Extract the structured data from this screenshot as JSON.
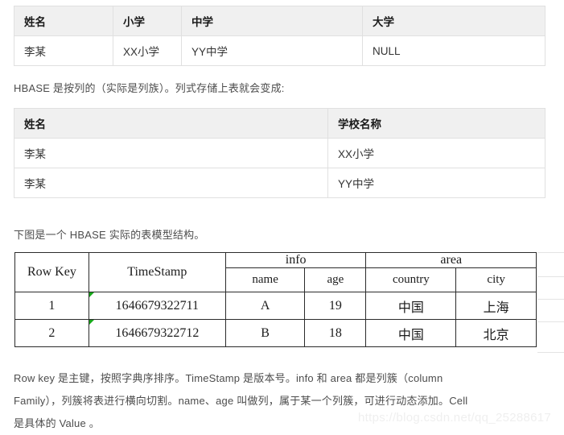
{
  "tables": {
    "schooling_wide": {
      "headers": [
        "姓名",
        "小学",
        "中学",
        "大学"
      ],
      "rows": [
        [
          "李某",
          "XX小学",
          "YY中学",
          "NULL"
        ]
      ]
    },
    "schooling_columnar": {
      "headers": [
        "姓名",
        "学校名称"
      ],
      "rows": [
        [
          "李某",
          "XX小学"
        ],
        [
          "李某",
          "YY中学"
        ]
      ]
    },
    "hbase_model": {
      "group_headers": [
        "Row Key",
        "TimeStamp",
        "info",
        "area"
      ],
      "sub_headers": [
        "name",
        "age",
        "country",
        "city"
      ],
      "rows": [
        [
          "1",
          "1646679322711",
          "A",
          "19",
          "中国",
          "上海"
        ],
        [
          "2",
          "1646679322712",
          "B",
          "18",
          "中国",
          "北京"
        ]
      ]
    }
  },
  "paragraphs": {
    "columnar_intro": "HBASE 是按列的（实际是列族）。列式存储上表就会变成:",
    "model_intro": "下图是一个 HBASE 实际的表模型结构。",
    "explanation_line1": "Row key 是主键，按照字典序排序。TimeStamp 是版本号。info 和 area 都是列簇（column",
    "explanation_line2": "Family），列簇将表进行横向切割。name、age 叫做列，属于某一个列簇，可进行动态添加。Cell",
    "explanation_line3": "是具体的 Value 。"
  },
  "watermark": {
    "text": "https://blog.csdn.net/qq_25288617"
  },
  "colors": {
    "header_bg": "#f0f0f0",
    "table_border": "#e0e0e0",
    "body_text": "#4d4d4d",
    "sheet_border": "#2b2b2b",
    "error_flag": "#17a81a",
    "watermark": "#efefef"
  }
}
